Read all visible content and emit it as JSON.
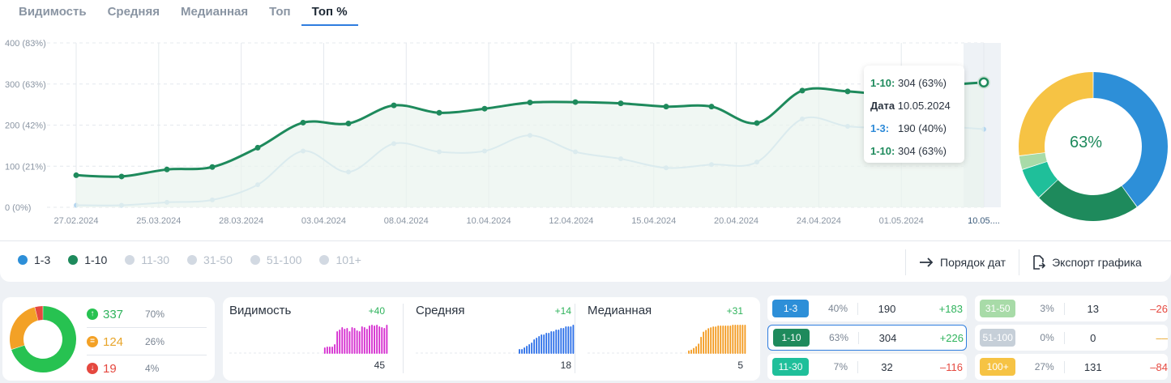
{
  "tabs": [
    {
      "label": "Видимость",
      "active": false
    },
    {
      "label": "Средняя",
      "active": false
    },
    {
      "label": "Медианная",
      "active": false
    },
    {
      "label": "Топ",
      "active": false
    },
    {
      "label": "Топ %",
      "active": true
    }
  ],
  "chart_data": {
    "type": "line",
    "y_ticks": [
      "0 (0%)",
      "100 (21%)",
      "200 (42%)",
      "300 (63%)",
      "400 (83%)"
    ],
    "ylim": [
      0,
      400
    ],
    "x_tick_labels": [
      "27.02.2024",
      "25.03.2024",
      "28.03.2024",
      "03.04.2024",
      "08.04.2024",
      "10.04.2024",
      "12.04.2024",
      "15.04.2024",
      "20.04.2024",
      "24.04.2024",
      "01.05.2024",
      "10.05...."
    ],
    "series": [
      {
        "name": "1-10",
        "color": "#1e8a5c",
        "values": [
          78,
          75,
          92,
          98,
          145,
          206,
          204,
          248,
          230,
          240,
          255,
          256,
          253,
          245,
          245,
          205,
          284,
          282,
          275,
          295,
          304
        ]
      },
      {
        "name": "1-3",
        "color": "#b7d7ef",
        "values": [
          5,
          5,
          12,
          18,
          55,
          137,
          86,
          155,
          135,
          137,
          175,
          135,
          118,
          96,
          104,
          110,
          215,
          197,
          193,
          197,
          190
        ]
      }
    ],
    "grid": true
  },
  "tooltip": {
    "head_label": "1-10:",
    "head_value": "304 (63%)",
    "date_label": "Дата",
    "date_value": "10.05.2024",
    "r1_label": "1-3:",
    "r1_value": "190 (40%)",
    "r2_label": "1-10:",
    "r2_value": "304 (63%)"
  },
  "donut_main": {
    "center_label": "63%",
    "segments": [
      {
        "color": "#2d8fd8",
        "value": 40
      },
      {
        "color": "#1e8a5c",
        "value": 23
      },
      {
        "color": "#1fbf9a",
        "value": 7
      },
      {
        "color": "#a8dba8",
        "value": 3
      },
      {
        "color": "#f6c344",
        "value": 27
      }
    ]
  },
  "legend": [
    {
      "label": "1-3",
      "color": "#2d8fd8",
      "off": false
    },
    {
      "label": "1-10",
      "color": "#1e8a5c",
      "off": false
    },
    {
      "label": "11-30",
      "color": "#d2d9e2",
      "off": true
    },
    {
      "label": "31-50",
      "color": "#d2d9e2",
      "off": true
    },
    {
      "label": "51-100",
      "color": "#d2d9e2",
      "off": true
    },
    {
      "label": "101+",
      "color": "#d2d9e2",
      "off": true
    }
  ],
  "actions": {
    "date_order_label": "Порядок дат",
    "export_label": "Экспорт графика"
  },
  "distribution": {
    "segments": [
      {
        "color": "#27c251",
        "value": 70
      },
      {
        "color": "#f3a126",
        "value": 26
      },
      {
        "color": "#e5483f",
        "value": 4
      }
    ],
    "rows": [
      {
        "value": "337",
        "percent": "70%",
        "color": "#27c251",
        "icon": "arrow-up-icon"
      },
      {
        "value": "124",
        "percent": "26%",
        "color": "#f3a126",
        "icon": "equal-icon"
      },
      {
        "value": "19",
        "percent": "4%",
        "color": "#e5483f",
        "icon": "arrow-down-icon"
      }
    ]
  },
  "metrics": [
    {
      "name": "Видимость",
      "delta": "+40",
      "value": "45",
      "color": "#d62fd0",
      "bars": [
        0,
        0,
        0,
        0,
        0,
        0,
        0,
        0,
        0,
        0,
        0,
        0,
        0,
        0,
        0,
        0,
        0,
        0,
        0,
        0,
        0,
        0,
        0,
        0,
        0,
        0,
        0,
        0,
        0,
        0,
        0,
        0,
        0,
        0,
        0,
        0,
        0,
        0,
        8,
        9,
        9,
        9,
        12,
        28,
        30,
        33,
        31,
        32,
        28,
        33,
        32,
        29,
        28,
        34,
        33,
        31,
        35,
        36,
        35,
        36,
        34,
        33,
        32,
        36
      ]
    },
    {
      "name": "Средняя",
      "delta": "+14",
      "value": "18",
      "color": "#2a6ee8",
      "bars": [
        0,
        0,
        0,
        0,
        0,
        0,
        0,
        0,
        0,
        0,
        0,
        0,
        0,
        0,
        0,
        0,
        0,
        0,
        0,
        0,
        0,
        0,
        0,
        0,
        0,
        0,
        0,
        0,
        0,
        0,
        0,
        0,
        0,
        0,
        0,
        0,
        0,
        0,
        0,
        0,
        0,
        0,
        3,
        3,
        4,
        5,
        6,
        7,
        9,
        10,
        11,
        12,
        12,
        13,
        13,
        14,
        14,
        15,
        15,
        16,
        16,
        17,
        17,
        17,
        18
      ]
    },
    {
      "name": "Медианная",
      "delta": "+31",
      "value": "5",
      "color": "#f39a1f",
      "bars": [
        0,
        0,
        0,
        0,
        0,
        0,
        0,
        0,
        0,
        0,
        0,
        0,
        0,
        0,
        0,
        0,
        0,
        0,
        0,
        0,
        0,
        0,
        0,
        0,
        0,
        0,
        0,
        0,
        0,
        0,
        0,
        0,
        0,
        0,
        0,
        0,
        0,
        0,
        0,
        0,
        0,
        4,
        5,
        7,
        9,
        12,
        20,
        26,
        28,
        30,
        31,
        32,
        32,
        33,
        33,
        33,
        33,
        33,
        33,
        34,
        34,
        34,
        34,
        34,
        34
      ]
    }
  ],
  "positions_left": [
    {
      "label": "1-3",
      "color": "#2d8fd8",
      "percent": "40%",
      "value": "190",
      "delta": "+183",
      "dir": "up",
      "selected": false
    },
    {
      "label": "1-10",
      "color": "#1e8a5c",
      "percent": "63%",
      "value": "304",
      "delta": "+226",
      "dir": "up",
      "selected": true
    },
    {
      "label": "11-30",
      "color": "#1fbf9a",
      "percent": "7%",
      "value": "32",
      "delta": "–116",
      "dir": "down",
      "selected": false
    }
  ],
  "positions_right": [
    {
      "label": "31-50",
      "color": "#a8dba8",
      "percent": "3%",
      "value": "13",
      "delta": "–26",
      "dir": "down",
      "selected": false
    },
    {
      "label": "51-100",
      "color": "#c6cfd8",
      "percent": "0%",
      "value": "0",
      "delta": "––",
      "dir": "neutral",
      "selected": false
    },
    {
      "label": "100+",
      "color": "#f6c344",
      "percent": "27%",
      "value": "131",
      "delta": "–84",
      "dir": "down",
      "selected": false
    }
  ]
}
